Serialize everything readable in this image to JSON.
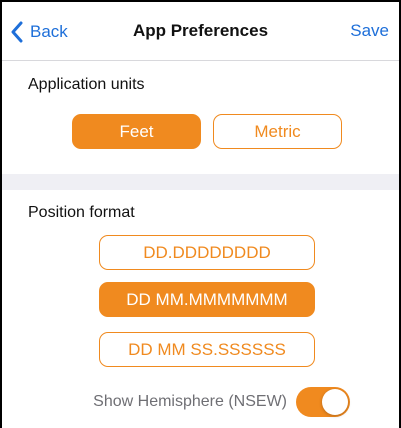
{
  "navbar": {
    "back_label": "Back",
    "title": "App Preferences",
    "save_label": "Save"
  },
  "units": {
    "label": "Application units",
    "options": [
      "Feet",
      "Metric"
    ],
    "selected": "Feet"
  },
  "position": {
    "label": "Position format",
    "options": [
      "DD.DDDDDDDD",
      "DD MM.MMMMMMM",
      "DD MM SS.SSSSSS"
    ],
    "selected": "DD MM.MMMMMMM"
  },
  "hemisphere": {
    "label": "Show Hemisphere (NSEW)",
    "enabled": true
  },
  "colors": {
    "accent": "#f08a1f",
    "link": "#1e6fd9",
    "section_gap": "#efeff4"
  },
  "icons": {
    "back": "chevron-left-icon"
  }
}
